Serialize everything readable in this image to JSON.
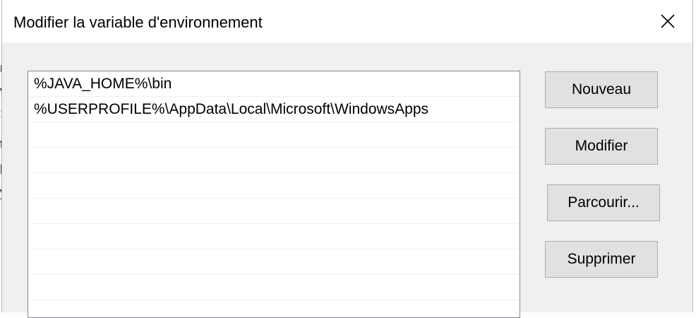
{
  "dialog": {
    "title": "Modifier la variable d'environnement",
    "close_icon": "close-icon"
  },
  "path_list": {
    "rows": [
      "%JAVA_HOME%\\bin",
      "%USERPROFILE%\\AppData\\Local\\Microsoft\\WindowsApps",
      "",
      "",
      "",
      "",
      "",
      "",
      "",
      ""
    ]
  },
  "buttons": {
    "new_label": "Nouveau",
    "edit_label": "Modifier",
    "browse_label": "Parcourir...",
    "delete_label": "Supprimer"
  },
  "background_window": {
    "fragments": [
      "r",
      "V",
      ":",
      "t",
      "l",
      "y"
    ]
  },
  "colors": {
    "dialog_bg": "#f0f0f0",
    "button_bg": "#e1e1e1",
    "button_border": "#adadad",
    "list_border": "#828790"
  }
}
